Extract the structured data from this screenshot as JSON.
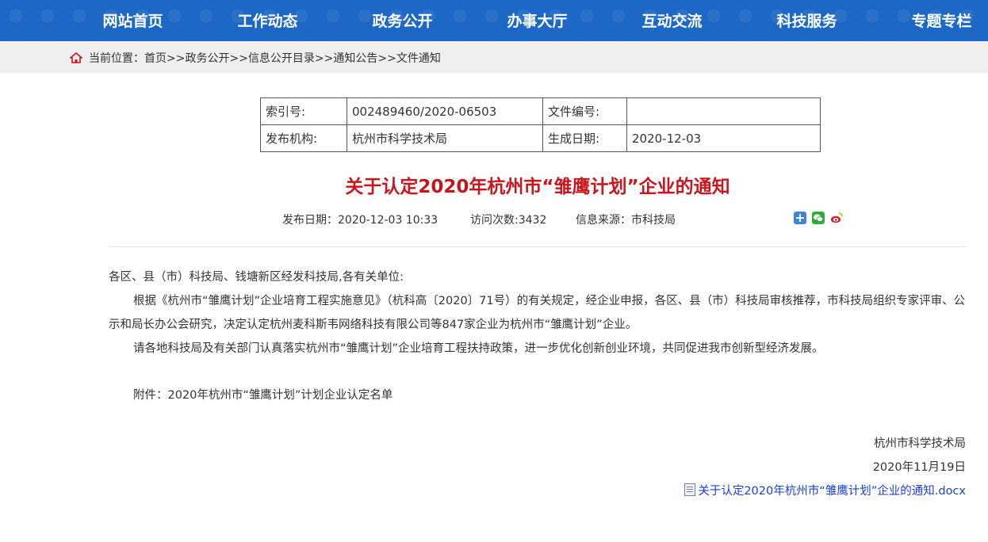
{
  "nav": {
    "items": [
      "网站首页",
      "工作动态",
      "政务公开",
      "办事大厅",
      "互动交流",
      "科技服务",
      "专题专栏"
    ]
  },
  "breadcrumb": {
    "prefix": "当前位置：",
    "items": [
      "首页",
      "政务公开",
      "信息公开目录",
      "通知公告",
      "文件通知"
    ],
    "separator": ">>"
  },
  "meta": {
    "index_label": "索引号:",
    "index_value": "002489460/2020-06503",
    "doc_no_label": "文件编号:",
    "doc_no_value": "",
    "publisher_label": "发布机构:",
    "publisher_value": "杭州市科学技术局",
    "gen_date_label": "生成日期:",
    "gen_date_value": "2020-12-03"
  },
  "article": {
    "title": "关于认定2020年杭州市“雏鹰计划”企业的通知",
    "publish_date": "发布日期：2020-12-03 10:33",
    "visits": "访问次数:3432",
    "source": "信息来源：市科技局",
    "salutation": "各区、县（市）科技局、钱塘新区经发科技局,各有关单位:",
    "para1": "根据《杭州市“雏鹰计划”企业培育工程实施意见》（杭科高〔2020〕71号）的有关规定，经企业申报，各区、县（市）科技局审核推荐，市科技局组织专家评审、公示和局长办公会研究，决定认定杭州麦科斯韦网络科技有限公司等847家企业为杭州市“雏鹰计划”企业。",
    "para2": "请各地科技局及有关部门认真落实杭州市“雏鹰计划”企业培育工程扶持政策，进一步优化创新创业环境，共同促进我市创新型经济发展。",
    "attachment_note": "附件：2020年杭州市“雏鹰计划”计划企业认定名单",
    "signer": "杭州市科学技术局",
    "sign_date": "2020年11月19日",
    "attachment_link": "关于认定2020年杭州市“雏鹰计划”企业的通知.docx"
  },
  "share_icons": [
    "add-share-icon",
    "wechat-icon",
    "weibo-icon"
  ],
  "colors": {
    "nav_bg": "#1d68c4",
    "title": "#c7161d",
    "link": "#1a3fd1"
  }
}
